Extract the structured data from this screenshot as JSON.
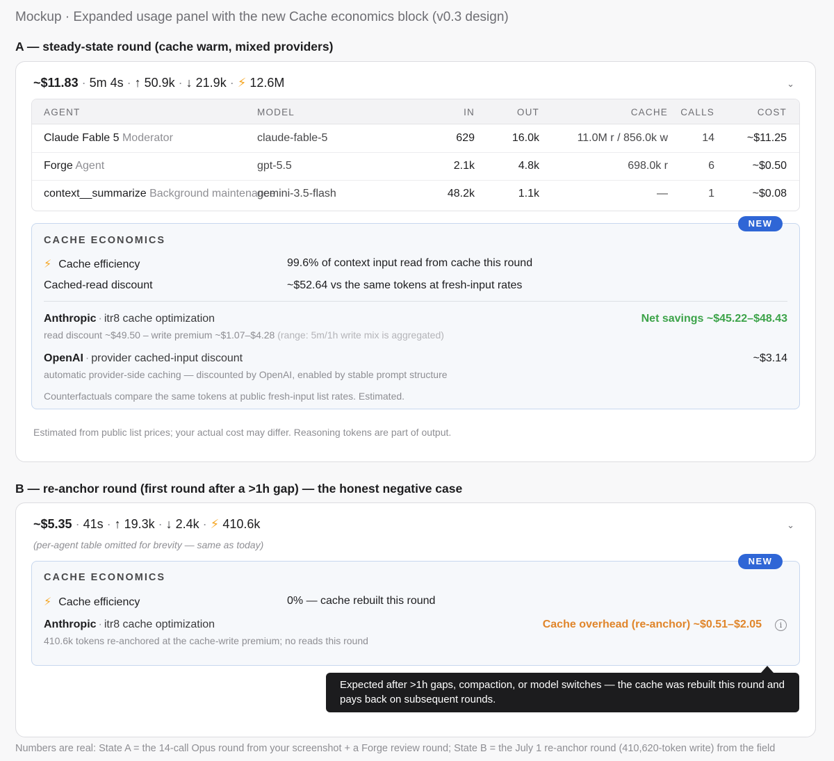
{
  "page_title": "Mockup · Expanded usage panel with the new Cache economics block (v0.3 design)",
  "section_a": {
    "title": "A — steady-state round (cache warm, mixed providers)",
    "summary": {
      "cost": "~$11.83",
      "duration": "5m 4s",
      "up": "↑ 50.9k",
      "down": "↓ 21.9k",
      "bolt": "⚡",
      "cache": "12.6M"
    },
    "chevron": "⌄",
    "table": {
      "headers": {
        "agent": "AGENT",
        "model": "MODEL",
        "in": "IN",
        "out": "OUT",
        "cache": "CACHE",
        "calls": "CALLS",
        "cost": "COST"
      },
      "rows": [
        {
          "agent": "Claude Fable 5",
          "role": "Moderator",
          "model": "claude-fable-5",
          "in": "629",
          "out": "16.0k",
          "cache": "11.0M r / 856.0k w",
          "calls": "14",
          "cost": "~$11.25"
        },
        {
          "agent": "Forge",
          "role": "Agent",
          "model": "gpt-5.5",
          "in": "2.1k",
          "out": "4.8k",
          "cache": "698.0k r",
          "calls": "6",
          "cost": "~$0.50"
        },
        {
          "agent": "context__summarize",
          "role": "Background maintenance",
          "model": "gemini-3.5-flash",
          "in": "48.2k",
          "out": "1.1k",
          "cache": "—",
          "calls": "1",
          "cost": "~$0.08"
        }
      ]
    },
    "economics": {
      "badge": "NEW",
      "title": "CACHE ECONOMICS",
      "efficiency_label": "Cache efficiency",
      "efficiency_value": "99.6% of context input read from cache this round",
      "discount_label": "Cached-read discount",
      "discount_value": "~$52.64 vs the same tokens at fresh-input rates",
      "anthropic": {
        "name": "Anthropic",
        "desc": "itr8 cache optimization",
        "savings": "Net savings ~$45.22–$48.43",
        "sub": "read discount ~$49.50 – write premium ~$1.07–$4.28",
        "sub_faint": "(range: 5m/1h write mix is aggregated)"
      },
      "openai": {
        "name": "OpenAI",
        "desc": "provider cached-input discount",
        "value": "~$3.14",
        "sub": "automatic provider-side caching — discounted by OpenAI, enabled by stable prompt structure"
      },
      "note": "Counterfactuals compare the same tokens at public fresh-input list rates. Estimated."
    },
    "footnote": "Estimated from public list prices; your actual cost may differ. Reasoning tokens are part of output."
  },
  "section_b": {
    "title": "B — re-anchor round (first round after a >1h gap) — the honest negative case",
    "summary": {
      "cost": "~$5.35",
      "duration": "41s",
      "up": "↑ 19.3k",
      "down": "↓ 2.4k",
      "bolt": "⚡",
      "cache": "410.6k"
    },
    "chevron": "⌄",
    "omitted_note": "(per-agent table omitted for brevity — same as today)",
    "economics": {
      "badge": "NEW",
      "title": "CACHE ECONOMICS",
      "efficiency_label": "Cache efficiency",
      "efficiency_value": "0% — cache rebuilt this round",
      "anthropic": {
        "name": "Anthropic",
        "desc": "itr8 cache optimization",
        "overhead": "Cache overhead (re-anchor) ~$0.51–$2.05",
        "sub": "410.6k tokens re-anchored at the cache-write premium; no reads this round"
      },
      "info_glyph": "i"
    },
    "tooltip": "Expected after >1h gaps, compaction, or model switches — the cache was rebuilt this round and pays back on subsequent rounds."
  },
  "bottom_note": "Numbers are real: State A = the 14-call Opus round from your screenshot + a Forge review round; State B = the July 1 re-anchor round (410,620-token write) from the field"
}
